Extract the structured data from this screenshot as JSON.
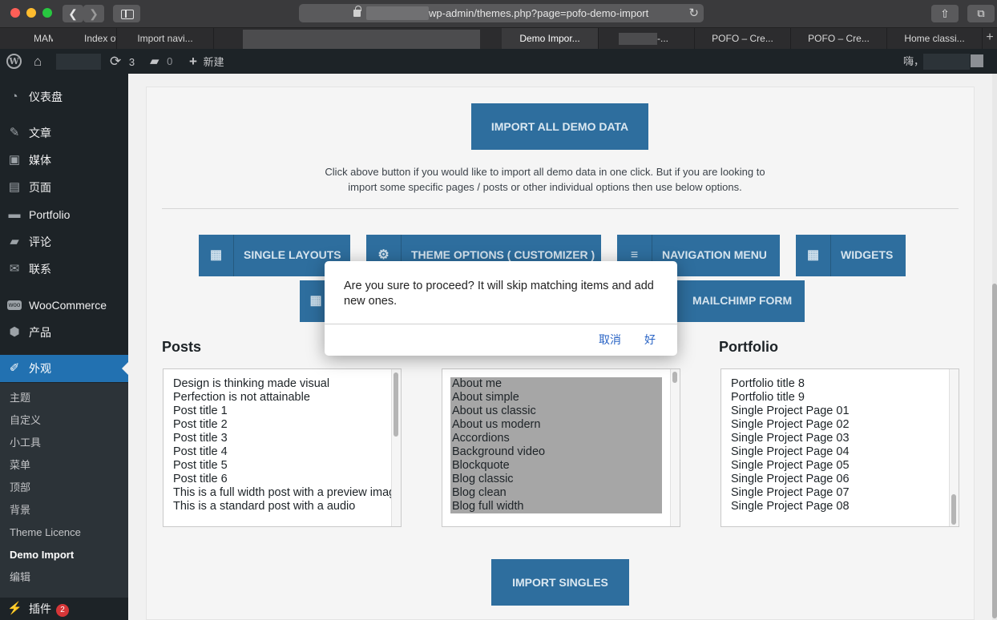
{
  "browser": {
    "url": "wp-admin/themes.php?page=pofo-demo-import",
    "tabs": [
      "MAM",
      "Index of",
      "Import navi...",
      "Demo Impor...",
      "-...",
      "POFO – Cre...",
      "POFO – Cre...",
      "Home classi..."
    ],
    "new_tab": "+"
  },
  "adminbar": {
    "updates_count": "3",
    "comments_count": "0",
    "new_label": "新建",
    "greeting": "嗨，"
  },
  "sidebar": {
    "items": [
      {
        "icon": "dashboard-icon",
        "label": "仪表盘"
      },
      {
        "icon": "pin-icon",
        "label": "文章"
      },
      {
        "icon": "media-icon",
        "label": "媒体"
      },
      {
        "icon": "page-icon",
        "label": "页面"
      },
      {
        "icon": "portfolio-icon",
        "label": "Portfolio"
      },
      {
        "icon": "comment-icon",
        "label": "评论"
      },
      {
        "icon": "mail-icon",
        "label": "联系"
      },
      {
        "icon": "woo-icon",
        "label": "WooCommerce"
      },
      {
        "icon": "product-icon",
        "label": "产品"
      },
      {
        "icon": "brush-icon",
        "label": "外观"
      }
    ],
    "submenu": [
      "主题",
      "自定义",
      "小工具",
      "菜单",
      "顶部",
      "背景",
      "Theme Licence",
      "Demo Import",
      "编辑"
    ],
    "plugins_label": "插件",
    "plugins_badge": "2"
  },
  "main": {
    "import_all_label": "IMPORT ALL DEMO DATA",
    "description": "Click above button if you would like to import all demo data in one click. But if you are looking to import some specific pages / posts or other individual options then use below options.",
    "option_buttons": [
      "SINGLE LAYOUTS",
      "THEME OPTIONS ( CUSTOMIZER )",
      "NAVIGATION MENU",
      "WIDGETS",
      "MAILCHIMP FORM"
    ],
    "posts_title": "Posts",
    "portfolio_title": "Portfolio",
    "posts": [
      "Design is thinking made visual",
      "Perfection is not attainable",
      "Post title 1",
      "Post title 2",
      "Post title 3",
      "Post title 4",
      "Post title 5",
      "Post title 6",
      "This is a full width post with a preview image",
      "This is a standard post with a audio"
    ],
    "pages": [
      "About me",
      "About simple",
      "About us classic",
      "About us modern",
      "Accordions",
      "Background video",
      "Blockquote",
      "Blog classic",
      "Blog clean",
      "Blog full width"
    ],
    "portfolio": [
      "Portfolio title 8",
      "Portfolio title 9",
      "Single Project Page 01",
      "Single Project Page 02",
      "Single Project Page 03",
      "Single Project Page 04",
      "Single Project Page 05",
      "Single Project Page 06",
      "Single Project Page 07",
      "Single Project Page 08"
    ],
    "import_singles_label": "IMPORT SINGLES"
  },
  "dialog": {
    "message": "Are you sure to proceed? It will skip matching items and add new ones.",
    "cancel": "取消",
    "ok": "好"
  },
  "colors": {
    "wp_blue": "#2271b1",
    "button_blue": "#2e6e9e",
    "admin_dark": "#1d2327"
  }
}
